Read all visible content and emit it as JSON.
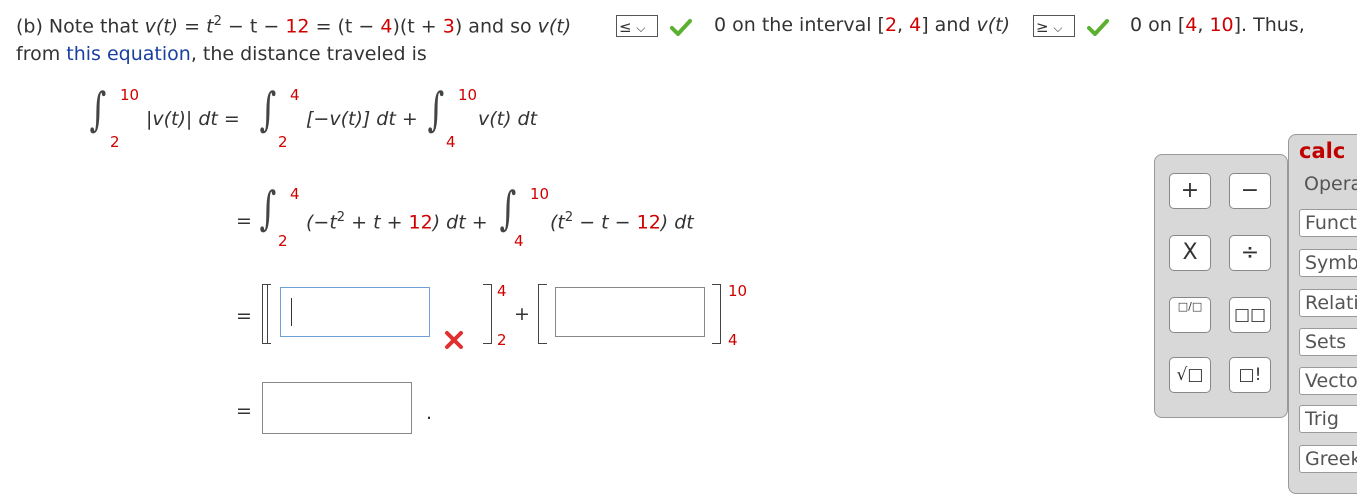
{
  "line1": {
    "part_label": "(b) Note that",
    "v_t": "v(t)",
    "eq1": "=",
    "t_sq": "t",
    "sq": "2",
    "minus_t": "− t −",
    "num12": "12",
    "eq2": "= (t −",
    "num4a": "4",
    "mid": ")(t +",
    "num3": "3",
    "and_so": ") and so",
    "v_t2": "v(t)",
    "dropdown1_value": "≤",
    "zero1": "0 on the interval [",
    "int_a": "2",
    "comma1": ", ",
    "int_b": "4",
    "and_v": "] and",
    "v_t3": "v(t)",
    "dropdown2_value": "≥",
    "zero2": "0 on [",
    "int_c": "4",
    "comma2": ", ",
    "int_d": "10",
    "thus": "]. Thus,"
  },
  "line2": {
    "from": "from",
    "link": "this equation",
    "rest": ", the distance traveled is"
  },
  "row1": {
    "upper1": "10",
    "lower1": "2",
    "integrand1": "|v(t)| dt  =",
    "upper2": "4",
    "lower2": "2",
    "integrand2": "[−v(t)] dt  +",
    "upper3": "10",
    "lower3": "4",
    "integrand3": "v(t) dt"
  },
  "row2": {
    "eq": "=",
    "upper1": "4",
    "lower1": "2",
    "integrand1_a": "(−t",
    "sq1": "2",
    "integrand1_b": " + t + ",
    "n12a": "12",
    "integrand1_c": ") dt  +",
    "upper2": "10",
    "lower2": "4",
    "integrand2_a": "(t",
    "sq2": "2",
    "integrand2_b": " − t − ",
    "n12b": "12",
    "integrand2_c": ") dt"
  },
  "row3": {
    "eq": "=",
    "answer1_value": "",
    "upper1": "4",
    "lower1": "2",
    "plus": "+",
    "answer2_value": "",
    "upper2": "10",
    "lower2": "4"
  },
  "row4": {
    "eq": "=",
    "answer3_value": "",
    "period": "."
  },
  "palette": {
    "buttons": [
      "+",
      "−",
      "X",
      "÷",
      "□/□",
      "□□",
      "√□",
      "□!"
    ]
  },
  "sidebar": {
    "title": "calc",
    "tabs": [
      "Opera",
      "Functi",
      "Symbo",
      "Relatio",
      "Sets",
      "Vector",
      "Trig",
      "Greek"
    ]
  },
  "colors": {
    "red": "#d00000",
    "blue": "#1a3fa0",
    "check": "#5cb030",
    "x_mark": "#e03030"
  }
}
